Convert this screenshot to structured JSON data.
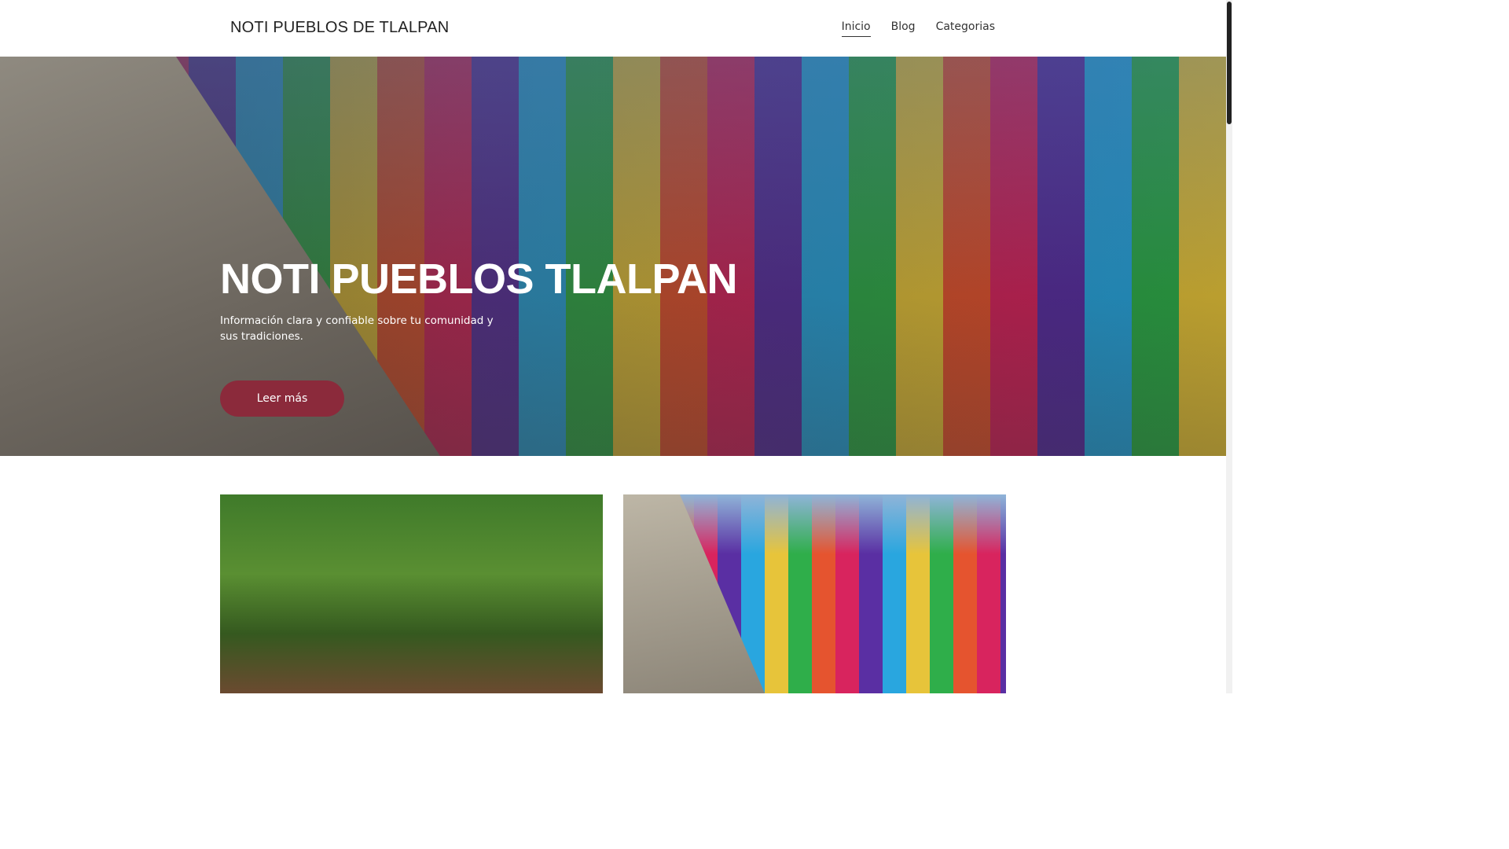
{
  "header": {
    "brand": "NOTI PUEBLOS DE TLALPAN",
    "nav": [
      {
        "label": "Inicio"
      },
      {
        "label": "Blog"
      },
      {
        "label": "Categorias"
      }
    ]
  },
  "hero": {
    "title": "NOTI PUEBLOS TLALPAN",
    "subtitle": "Información clara y confiable sobre tu comunidad y sus tradiciones.",
    "button": "Leer más"
  },
  "colors": {
    "accent": "#8b2a3b"
  }
}
